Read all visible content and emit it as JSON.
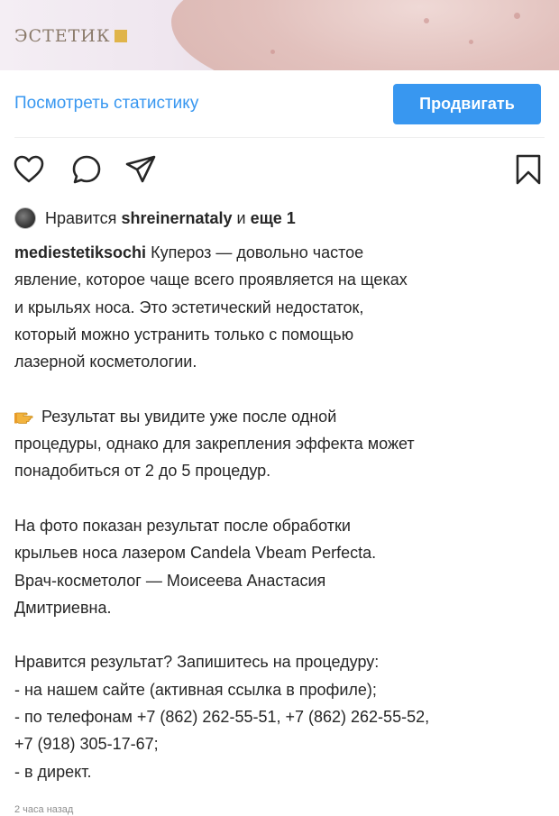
{
  "post": {
    "brand_logo_text": "ЭСТЕТИК",
    "stats_link_label": "Посмотреть статистику",
    "promote_button_label": "Продвигать",
    "likes": {
      "prefix": "Нравится",
      "user": "shreinernataly",
      "connector": "и",
      "others": "еще 1"
    },
    "caption": {
      "username": "mediestetiksochi",
      "first_line_rest": "Купероз — довольно частое",
      "lines": [
        "явление, которое чаще всего проявляется на щеках",
        "и крыльях носа. Это эстетический недостаток,",
        "который можно устранить только с помощью",
        "лазерной косметологии.",
        "",
        "Результат вы увидите уже после одной",
        "процедуры, однако для закрепления эффекта может",
        "понадобиться от 2 до 5 процедур.",
        "",
        "На фото показан результат после обработки",
        "крыльев носа лазером Candela Vbeam Perfecta.",
        "Врач-косметолог — Моисеева Анастасия",
        "Дмитриевна.",
        "",
        "Нравится результат? Запишитесь на процедуру:",
        "- на нашем сайте (активная ссылка в профиле);",
        "- по телефонам +7 (862) 262-55-51, +7 (862) 262-55-52,",
        "+7 (918) 305-17-67;",
        "- в директ."
      ]
    },
    "timestamp": "2 часа назад"
  },
  "icons": {
    "like": "heart-icon",
    "comment": "comment-icon",
    "share": "share-icon",
    "save": "bookmark-icon",
    "pointer": "pointing-hand-emoji"
  },
  "colors": {
    "accent": "#3897f0",
    "text": "#262626",
    "muted": "#8e8e8e"
  }
}
